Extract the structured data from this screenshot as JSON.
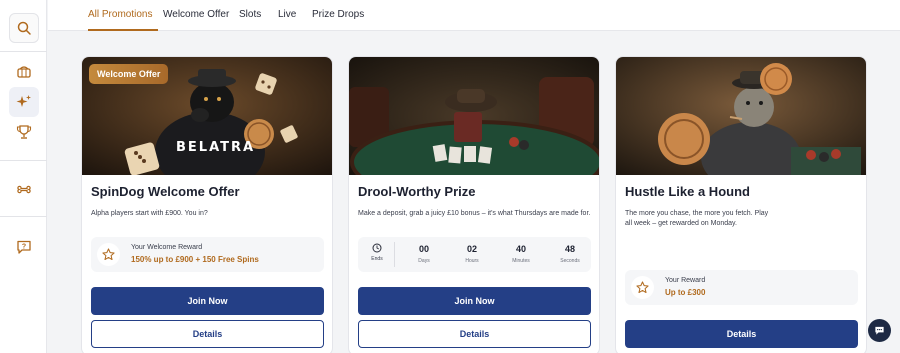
{
  "sidebar": {
    "icons": [
      "search-icon",
      "slots-basket-icon",
      "sparkles-icon",
      "trophy-icon",
      "bone-icon",
      "help-chat-icon"
    ]
  },
  "tabs": [
    {
      "label": "All Promotions",
      "active": true
    },
    {
      "label": "Welcome Offer",
      "active": false
    },
    {
      "label": "Slots",
      "active": false
    },
    {
      "label": "Live",
      "active": false
    },
    {
      "label": "Prize Drops",
      "active": false
    }
  ],
  "cards": [
    {
      "badge": "Welcome Offer",
      "image_text": "BELATRA",
      "title": "SpinDog Welcome Offer",
      "description": "Alpha players start with £900. You in?",
      "reward_label": "Your Welcome Reward",
      "reward_value": "150% up to £900 + 150 Free Spins",
      "primary_button": "Join Now",
      "secondary_button": "Details"
    },
    {
      "title": "Drool-Worthy Prize",
      "description": "Make a deposit, grab a juicy £10 bonus – it's what Thursdays are made for.",
      "countdown": {
        "ends_label": "Ends",
        "units": [
          {
            "value": "00",
            "label": "Days"
          },
          {
            "value": "02",
            "label": "Hours"
          },
          {
            "value": "40",
            "label": "Minutes"
          },
          {
            "value": "48",
            "label": "Seconds"
          }
        ]
      },
      "primary_button": "Join Now",
      "secondary_button": "Details"
    },
    {
      "title": "Hustle Like a Hound",
      "description": "The more you chase, the more you fetch. Play all week – get rewarded on Monday.",
      "reward_label": "Your Reward",
      "reward_value": "Up to £300",
      "primary_button": "Details"
    }
  ],
  "colors": {
    "accent": "#b06a1e",
    "primary_button": "#243f86",
    "page_bg": "#f3f4f6"
  },
  "chat_icon": "chat-bubble-icon"
}
